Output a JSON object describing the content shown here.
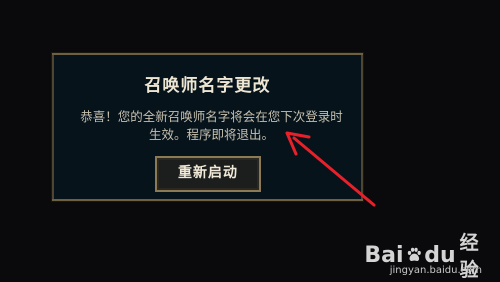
{
  "dialog": {
    "title": "召唤师名字更改",
    "message": "恭喜！您的全新召唤师名字将会在您下次登录时生效。程序即将退出。",
    "restart_button_label": "重新启动"
  },
  "watermark": {
    "brand": "Bai",
    "brand_tail": "du",
    "product": "经验",
    "url": "jingyan.baidu.com"
  },
  "colors": {
    "background": "#0a0a0c",
    "dialog_bg": "#06131b",
    "border_gold": "#8b7a55",
    "annotation_arrow": "#e8202a"
  }
}
